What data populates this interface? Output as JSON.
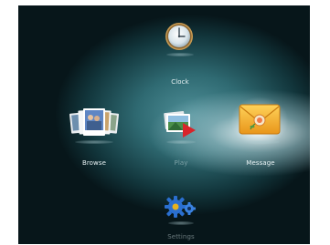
{
  "menu": {
    "items": [
      {
        "label": "Clock",
        "icon": "clock-icon",
        "state": "normal"
      },
      {
        "label": "Browse",
        "icon": "photo-stack-icon",
        "state": "normal"
      },
      {
        "label": "Play",
        "icon": "slideshow-play-icon",
        "state": "dimmed"
      },
      {
        "label": "Message",
        "icon": "envelope-icon",
        "state": "selected"
      },
      {
        "label": "Settings",
        "icon": "gear-icon",
        "state": "dimmed"
      }
    ]
  },
  "colors": {
    "background_dark": "#07161a",
    "background_teal": "#2f6a72",
    "label": "#e8f2f4",
    "envelope": "#f2b02a",
    "gear": "#2a6fd0"
  }
}
